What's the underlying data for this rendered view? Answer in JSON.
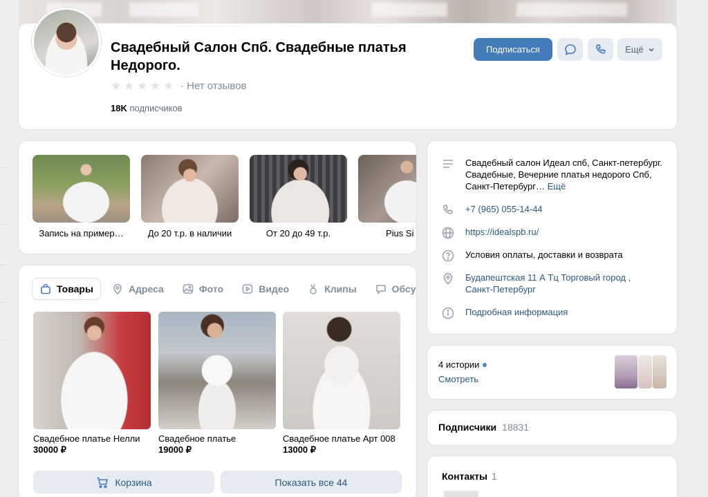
{
  "group": {
    "title": "Свадебный Салон Спб. Свадебные платья Недорого.",
    "rating_text": "· Нет отзывов",
    "subscribers_count": "18K",
    "subscribers_label": "подписчиков"
  },
  "actions": {
    "subscribe": "Подписаться",
    "more": "Ещё"
  },
  "albums": [
    {
      "label": "Запись на пример…"
    },
    {
      "label": "До 20 т.р. в наличии"
    },
    {
      "label": "От 20 до 49 т.р."
    },
    {
      "label": "Pius Si"
    }
  ],
  "tabs": [
    {
      "label": "Товары",
      "icon": "bag-icon"
    },
    {
      "label": "Адреса",
      "icon": "location-icon"
    },
    {
      "label": "Фото",
      "icon": "photo-icon"
    },
    {
      "label": "Видео",
      "icon": "video-icon"
    },
    {
      "label": "Клипы",
      "icon": "clips-icon"
    },
    {
      "label": "Обсу",
      "icon": "discussion-icon"
    }
  ],
  "products": [
    {
      "name": "Свадебное платье Нелли",
      "price": "30000 ₽"
    },
    {
      "name": "Свадебное платье",
      "price": "19000 ₽"
    },
    {
      "name": "Свадебное платье Арт 008",
      "price": "13000 ₽"
    }
  ],
  "goods_actions": {
    "cart": "Корзина",
    "show_all": "Показать все 44"
  },
  "info": {
    "description": "Свадебный салон Идеал спб, Санкт-петербург. Свадебные, Вечерние платья недорого Спб, Санкт-Петербург…",
    "more_link": "Ещё",
    "phone": "+7 (965) 055-14-44",
    "website": "https://idealspb.ru/",
    "payment_terms": "Условия оплаты, доставки и возврата",
    "address": "Будапештская 11 А Тц Торговый город , Санкт-Петербург",
    "details": "Подробная информация"
  },
  "stories": {
    "count_label": "4 истории",
    "watch": "Смотреть"
  },
  "subscribers_block": {
    "label": "Подписчики",
    "count": "18831"
  },
  "contacts_block": {
    "label": "Контакты",
    "count": "1"
  },
  "colors": {
    "accent": "#447bba",
    "link": "#2a5885",
    "background": "#edeef0",
    "secondary_button": "#e5ebf1",
    "story_dot": "#4986cc"
  }
}
